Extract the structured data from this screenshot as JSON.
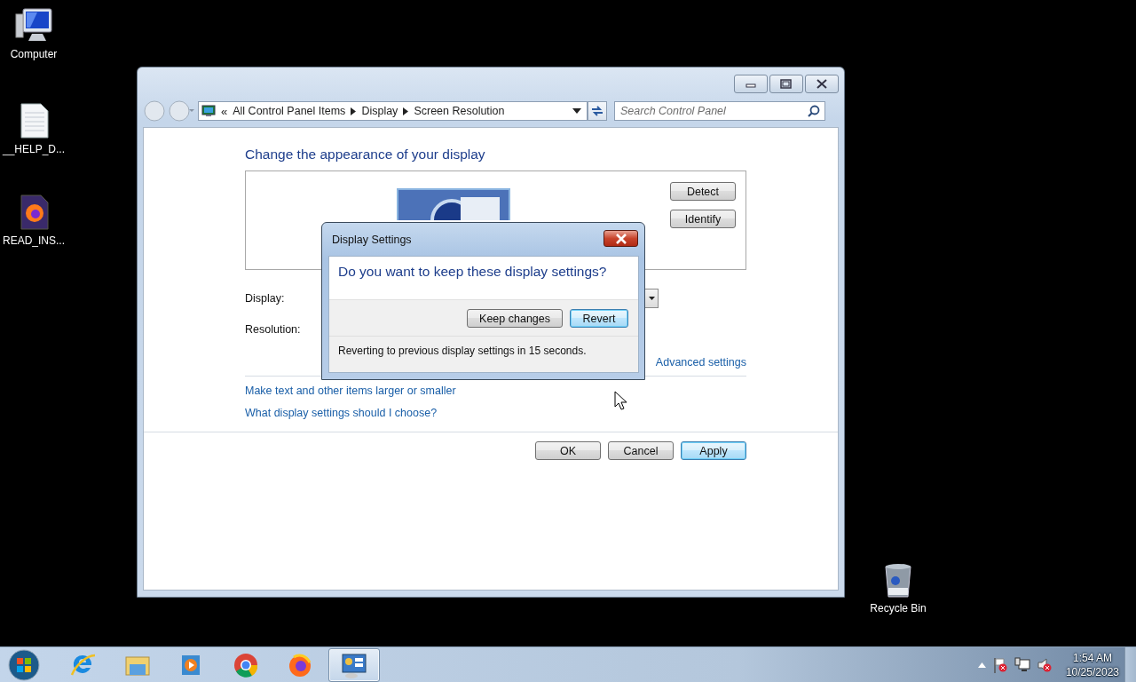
{
  "desktop_icons": [
    {
      "label": "Computer",
      "kind": "computer"
    },
    {
      "label": "__HELP_D...",
      "kind": "text-file"
    },
    {
      "label": "READ_INS...",
      "kind": "firefox-file"
    },
    {
      "label": "Recycle Bin",
      "kind": "recycle-bin"
    }
  ],
  "window": {
    "breadcrumb": [
      {
        "label": "«",
        "kind": "chevron"
      },
      {
        "label": "All Control Panel Items",
        "kind": "crumb"
      },
      {
        "label": "Display",
        "kind": "crumb"
      },
      {
        "label": "Screen Resolution",
        "kind": "crumb"
      }
    ],
    "search": {
      "placeholder": "Search Control Panel"
    },
    "heading": "Change the appearance of your display",
    "monitor_buttons": [
      "Detect",
      "Identify"
    ],
    "fields": [
      {
        "label": "Display:"
      },
      {
        "label": "Resolution:"
      }
    ],
    "advanced_link": "Advanced settings",
    "links": [
      "Make text and other items larger or smaller",
      "What display settings should I choose?"
    ],
    "buttons": [
      {
        "label": "OK",
        "default": false
      },
      {
        "label": "Cancel",
        "default": false
      },
      {
        "label": "Apply",
        "default": true
      }
    ]
  },
  "dialog": {
    "title": "Display Settings",
    "question": "Do you want to keep these display settings?",
    "buttons": [
      {
        "label": "Keep changes",
        "default": false
      },
      {
        "label": "Revert",
        "default": true
      }
    ],
    "status": "Reverting to previous display settings in 15 seconds."
  },
  "taskbar": {
    "apps": [
      {
        "kind": "ie",
        "active": false
      },
      {
        "kind": "explorer",
        "active": false
      },
      {
        "kind": "media",
        "active": false
      },
      {
        "kind": "chrome",
        "active": false
      },
      {
        "kind": "firefox",
        "active": false
      },
      {
        "kind": "control-panel",
        "active": true
      }
    ],
    "time": "1:54 AM",
    "date": "10/25/2023"
  }
}
